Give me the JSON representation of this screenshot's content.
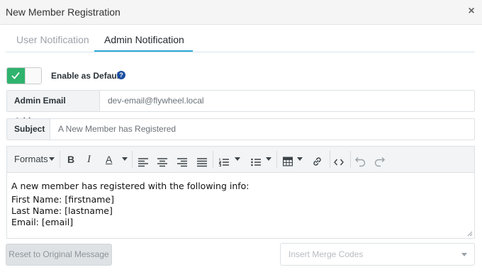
{
  "dialog": {
    "title": "New Member Registration",
    "close_glyph": "×"
  },
  "tabs": [
    {
      "label": "User Notification",
      "active": false
    },
    {
      "label": "Admin Notification",
      "active": true
    }
  ],
  "toggle": {
    "label": "Enable as Default",
    "on": true,
    "help_glyph": "?"
  },
  "fields": {
    "admin_email": {
      "label": "Admin Email Address",
      "value": "dev-email@flywheel.local"
    },
    "subject": {
      "label": "Subject",
      "value": "A New Member has Registered"
    }
  },
  "toolbar": {
    "formats_label": "Formats",
    "bold_label": "B",
    "italic_label": "I",
    "text_color_label": "A",
    "icons": [
      "bold-icon",
      "italic-icon",
      "text-color-icon",
      "align-left-icon",
      "align-center-icon",
      "align-right-icon",
      "align-justify-icon",
      "numbered-list-icon",
      "bulleted-list-icon",
      "table-icon",
      "link-icon",
      "code-icon",
      "undo-icon",
      "redo-icon"
    ]
  },
  "editor": {
    "lines": [
      "A new member has registered with the following info:",
      "First Name: [firstname]",
      "Last Name: [lastname]",
      "Email: [email]"
    ]
  },
  "footer": {
    "reset_label": "Reset to Original Message",
    "merge_placeholder": "Insert Merge Codes"
  },
  "colors": {
    "accent_tab": "#2ca9d6",
    "toggle_on": "#2fb36d",
    "help_badge": "#1c4fa0"
  }
}
